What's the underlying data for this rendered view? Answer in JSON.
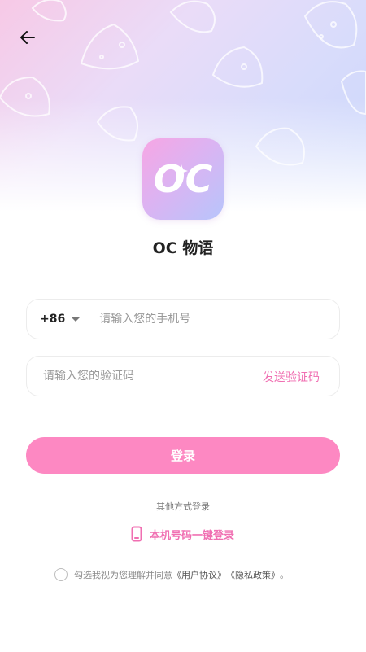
{
  "header": {
    "back_icon": "arrow-left-icon"
  },
  "app": {
    "name": "OC 物语",
    "logo_text": "OC"
  },
  "phone": {
    "country_code": "+86",
    "placeholder": "请输入您的手机号"
  },
  "code": {
    "placeholder": "请输入您的验证码",
    "send_label": "发送验证码"
  },
  "login": {
    "label": "登录"
  },
  "other": {
    "label": "其他方式登录",
    "onekey_label": "本机号码一键登录",
    "onekey_icon": "phone-icon"
  },
  "agreement": {
    "prefix": "勾选我视为您理解并同意",
    "user_agreement": "《用户协议》",
    "privacy_policy": "《隐私政策》",
    "suffix": "。"
  },
  "colors": {
    "accent": "#f06fb2",
    "button": "#fd88c2"
  }
}
